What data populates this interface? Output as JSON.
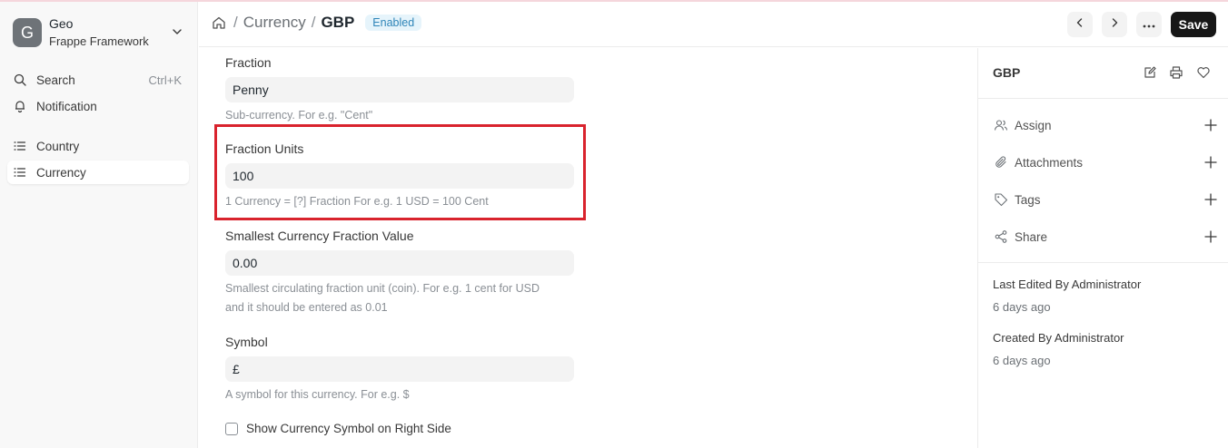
{
  "app": {
    "logo_letter": "G",
    "name": "Geo",
    "subtitle": "Frappe Framework"
  },
  "sidebar": {
    "search_label": "Search",
    "search_shortcut": "Ctrl+K",
    "notification_label": "Notification",
    "items": [
      {
        "label": "Country"
      },
      {
        "label": "Currency"
      }
    ]
  },
  "header": {
    "breadcrumb_parent": "Currency",
    "breadcrumb_current": "GBP",
    "status_badge": "Enabled",
    "save_label": "Save"
  },
  "form": {
    "fraction": {
      "label": "Fraction",
      "value": "Penny",
      "description": "Sub-currency. For e.g. \"Cent\""
    },
    "fraction_units": {
      "label": "Fraction Units",
      "value": "100",
      "description": "1 Currency = [?] Fraction For e.g. 1 USD = 100 Cent"
    },
    "smallest_fraction": {
      "label": "Smallest Currency Fraction Value",
      "value": "0.00",
      "description_line1": "Smallest circulating fraction unit (coin). For e.g. 1 cent for USD",
      "description_line2": "and it should be entered as 0.01"
    },
    "symbol": {
      "label": "Symbol",
      "value": "£",
      "description": "A symbol for this currency. For e.g. $"
    },
    "symbol_right": {
      "label": "Show Currency Symbol on Right Side",
      "checked": false
    }
  },
  "rpanel": {
    "title": "GBP",
    "actions": [
      {
        "label": "Assign"
      },
      {
        "label": "Attachments"
      },
      {
        "label": "Tags"
      },
      {
        "label": "Share"
      }
    ],
    "last_edited": "Last Edited By Administrator",
    "last_edited_time": "6 days ago",
    "created": "Created By Administrator",
    "created_time": "6 days ago"
  },
  "colors": {
    "highlight": "#d9232d",
    "badge_bg": "#e6f4fb",
    "badge_text": "#2f85b8",
    "save_bg": "#171717"
  }
}
